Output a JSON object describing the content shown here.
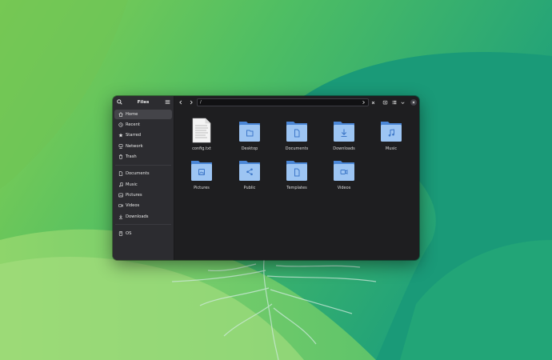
{
  "sidebar": {
    "title": "Files",
    "places": [
      {
        "label": "Home",
        "icon": "home-icon",
        "active": true
      },
      {
        "label": "Recent",
        "icon": "clock-icon"
      },
      {
        "label": "Starred",
        "icon": "star-icon"
      },
      {
        "label": "Network",
        "icon": "network-icon"
      },
      {
        "label": "Trash",
        "icon": "trash-icon"
      }
    ],
    "bookmarks": [
      {
        "label": "Documents",
        "icon": "document-icon"
      },
      {
        "label": "Music",
        "icon": "music-icon"
      },
      {
        "label": "Pictures",
        "icon": "picture-icon"
      },
      {
        "label": "Videos",
        "icon": "video-icon"
      },
      {
        "label": "Downloads",
        "icon": "download-icon"
      }
    ],
    "devices": [
      {
        "label": "OS",
        "icon": "drive-icon"
      }
    ]
  },
  "toolbar": {
    "path": "/"
  },
  "files": [
    {
      "name": "config.txt",
      "type": "text-file-icon"
    },
    {
      "name": "Desktop",
      "type": "folder-desktop-icon"
    },
    {
      "name": "Documents",
      "type": "folder-documents-icon"
    },
    {
      "name": "Downloads",
      "type": "folder-downloads-icon"
    },
    {
      "name": "Music",
      "type": "folder-music-icon"
    },
    {
      "name": "Pictures",
      "type": "folder-pictures-icon"
    },
    {
      "name": "Public",
      "type": "folder-public-icon"
    },
    {
      "name": "Templates",
      "type": "folder-templates-icon"
    },
    {
      "name": "Videos",
      "type": "folder-videos-icon"
    }
  ],
  "colors": {
    "folder_back": "#4a86d6",
    "folder_front": "#9dc5f3",
    "folder_emblem": "#3d77c8",
    "window_bg": "#1e1e20",
    "sidebar_bg": "#2c2c30"
  }
}
